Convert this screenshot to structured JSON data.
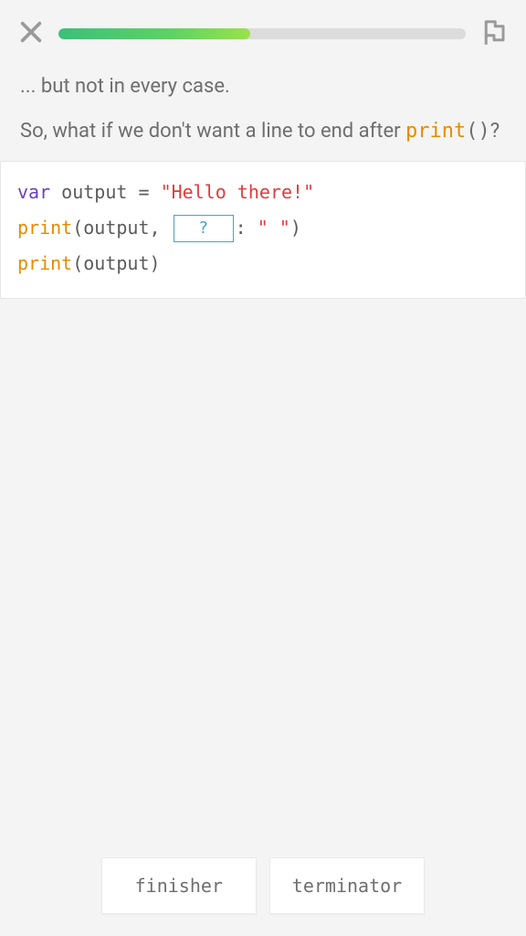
{
  "progress": {
    "percent": 47
  },
  "content": {
    "line1": "... but not in every case.",
    "line2_prefix": "So, what if we don't want a line to end after ",
    "line2_code_func": "print",
    "line2_code_parens": "()",
    "line2_suffix": "?"
  },
  "code": {
    "l1": {
      "keyword": "var",
      "ident": "output",
      "equals": "=",
      "string": "\"Hello there!\""
    },
    "l2": {
      "func": "print",
      "open": "(",
      "ident": "output",
      "comma": ",",
      "blank": "?",
      "colon": ":",
      "string": "\" \"",
      "close": ")"
    },
    "l3": {
      "func": "print",
      "open": "(",
      "ident": "output",
      "close": ")"
    }
  },
  "answers": {
    "opt1": "finisher",
    "opt2": "terminator"
  }
}
